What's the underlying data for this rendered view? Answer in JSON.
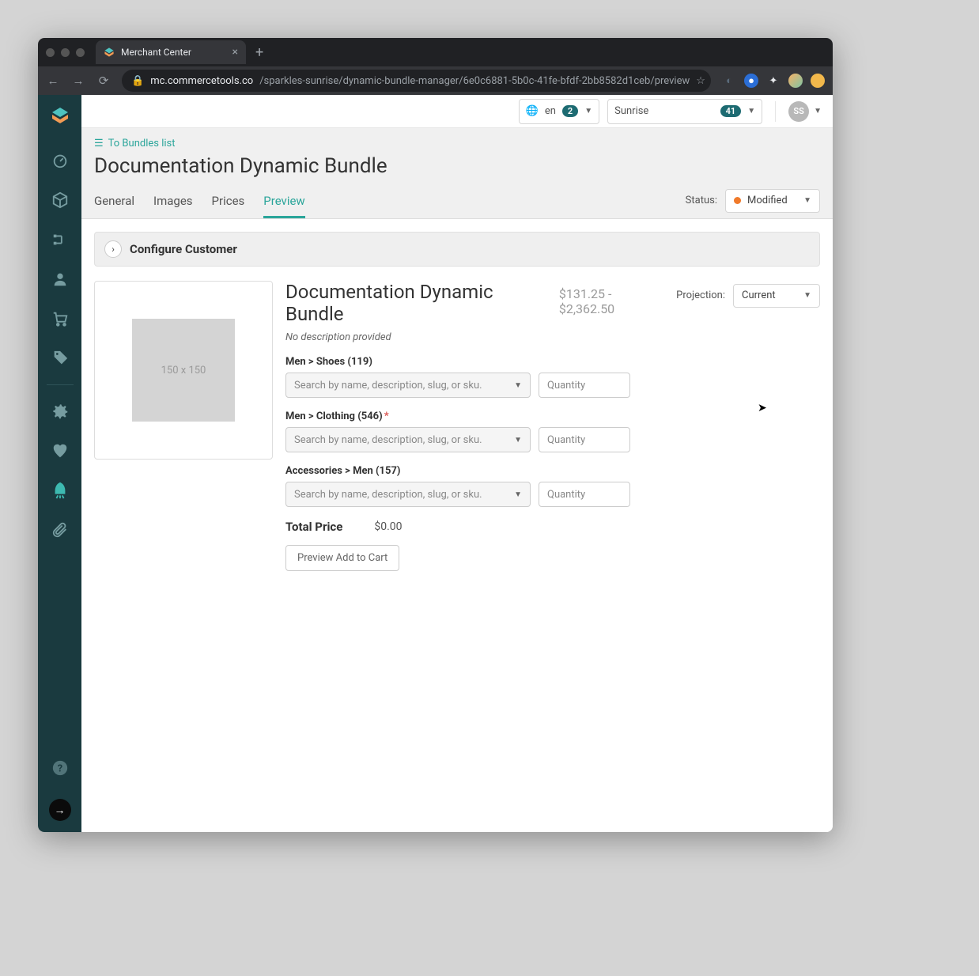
{
  "browser": {
    "tab_title": "Merchant Center",
    "url_host": "mc.commercetools.co",
    "url_path": "/sparkles-sunrise/dynamic-bundle-manager/6e0c6881-5b0c-41fe-bfdf-2bb8582d1ceb/preview"
  },
  "topbar": {
    "lang": "en",
    "lang_badge": "2",
    "project": "Sunrise",
    "project_badge": "41",
    "avatar": "SS"
  },
  "page": {
    "breadcrumb": "To Bundles list",
    "title": "Documentation Dynamic Bundle",
    "tabs": [
      "General",
      "Images",
      "Prices",
      "Preview"
    ],
    "active_tab": "Preview",
    "status_label": "Status:",
    "status_value": "Modified"
  },
  "configure": {
    "title": "Configure Customer"
  },
  "detail": {
    "title": "Documentation Dynamic Bundle",
    "price_range": "$131.25 - $2,362.50",
    "projection_label": "Projection:",
    "projection_value": "Current",
    "no_description": "No description provided",
    "image_placeholder": "150 x 150",
    "categories": [
      {
        "label": "Men > Shoes (119)",
        "required": false
      },
      {
        "label": "Men > Clothing (546)",
        "required": true
      },
      {
        "label": "Accessories > Men (157)",
        "required": false
      }
    ],
    "search_placeholder": "Search by name, description, slug, or sku.",
    "qty_placeholder": "Quantity",
    "total_label": "Total Price",
    "total_value": "$0.00",
    "preview_btn": "Preview Add to Cart"
  }
}
